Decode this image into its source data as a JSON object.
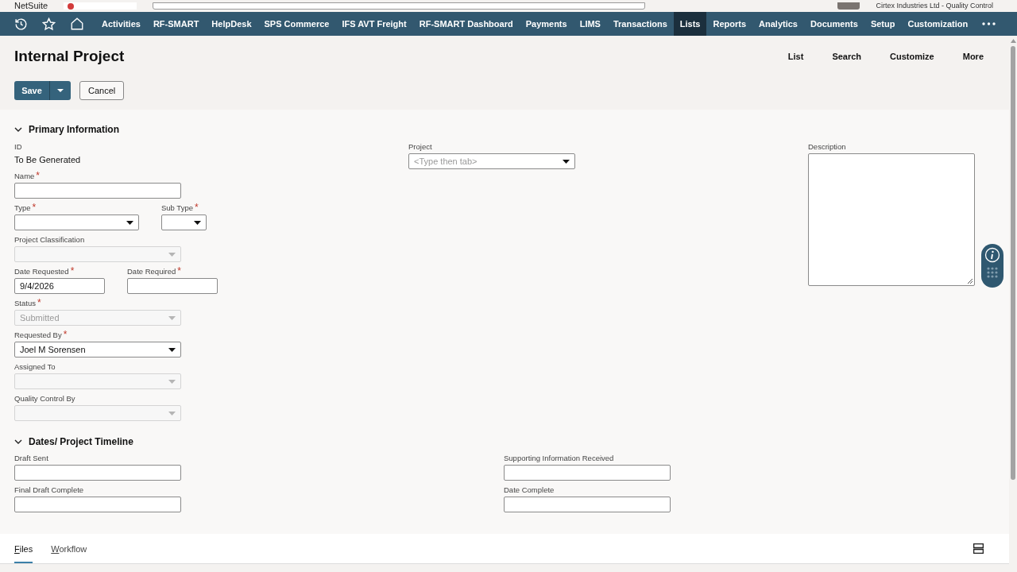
{
  "header": {
    "brand": "NetSuite",
    "company": "Cirtex Industries Ltd - Quality Control"
  },
  "nav": {
    "items": [
      {
        "label": "Activities",
        "selected": false
      },
      {
        "label": "RF-SMART",
        "selected": false
      },
      {
        "label": "HelpDesk",
        "selected": false
      },
      {
        "label": "SPS Commerce",
        "selected": false
      },
      {
        "label": "IFS AVT Freight",
        "selected": false
      },
      {
        "label": "RF-SMART Dashboard",
        "selected": false
      },
      {
        "label": "Payments",
        "selected": false
      },
      {
        "label": "LIMS",
        "selected": false
      },
      {
        "label": "Transactions",
        "selected": false
      },
      {
        "label": "Lists",
        "selected": true
      },
      {
        "label": "Reports",
        "selected": false
      },
      {
        "label": "Analytics",
        "selected": false
      },
      {
        "label": "Documents",
        "selected": false
      },
      {
        "label": "Setup",
        "selected": false
      },
      {
        "label": "Customization",
        "selected": false
      }
    ]
  },
  "page": {
    "title": "Internal Project",
    "links": [
      "List",
      "Search",
      "Customize",
      "More"
    ],
    "buttons": {
      "save": "Save",
      "cancel": "Cancel"
    }
  },
  "primary_information": {
    "title": "Primary Information",
    "expanded": true,
    "column_1": [
      [
        {
          "kind": "static",
          "label": "ID",
          "value": "To Be Generated"
        }
      ],
      [
        {
          "kind": "text",
          "label": "Name",
          "required_mark": "*",
          "disabled": false
        }
      ],
      [
        {
          "kind": "select",
          "label": "Type",
          "required_mark": "*",
          "disabled": false
        },
        {
          "kind": "select",
          "label": "Sub Type",
          "required_mark": "*",
          "disabled": false
        }
      ],
      [
        {
          "kind": "select",
          "label": "Project Classification",
          "disabled": true
        }
      ],
      [
        {
          "kind": "text",
          "label": "Date Requested",
          "required_mark": "*",
          "disabled": false,
          "value": "9/4/2026"
        },
        {
          "kind": "text",
          "label": "Date Required",
          "required_mark": "*",
          "disabled": false
        }
      ],
      [
        {
          "kind": "select",
          "label": "Status",
          "required_mark": "*",
          "disabled": true,
          "value": "Submitted"
        }
      ],
      [
        {
          "kind": "select",
          "label": "Requested By",
          "required_mark": "*",
          "disabled": false,
          "value": "Joel M Sorensen"
        }
      ],
      [
        {
          "kind": "select",
          "label": "Assigned To",
          "disabled": true
        }
      ],
      [
        {
          "kind": "select",
          "label": "Quality Control By",
          "disabled": true
        }
      ]
    ],
    "column_2": [
      [
        {
          "kind": "select",
          "label": "Project",
          "disabled": false,
          "placeholder": "<Type then tab>"
        }
      ]
    ],
    "column_3": [
      [
        {
          "kind": "textarea",
          "label": "Description",
          "disabled": false
        }
      ]
    ]
  },
  "timeline": {
    "title": "Dates/ Project Timeline",
    "expanded": true,
    "column_1": [
      [
        {
          "kind": "text",
          "label": "Draft Sent",
          "disabled": false
        }
      ],
      [
        {
          "kind": "text",
          "label": "Final Draft Complete",
          "disabled": false
        }
      ]
    ],
    "column_2": [
      [
        {
          "kind": "text",
          "label": "Supporting Information Received",
          "disabled": false
        }
      ],
      [
        {
          "kind": "text",
          "label": "Date Complete",
          "disabled": false
        }
      ]
    ]
  },
  "subtabs": [
    {
      "label": "Files",
      "selected": true
    },
    {
      "label": "Workflow",
      "selected": false
    }
  ]
}
